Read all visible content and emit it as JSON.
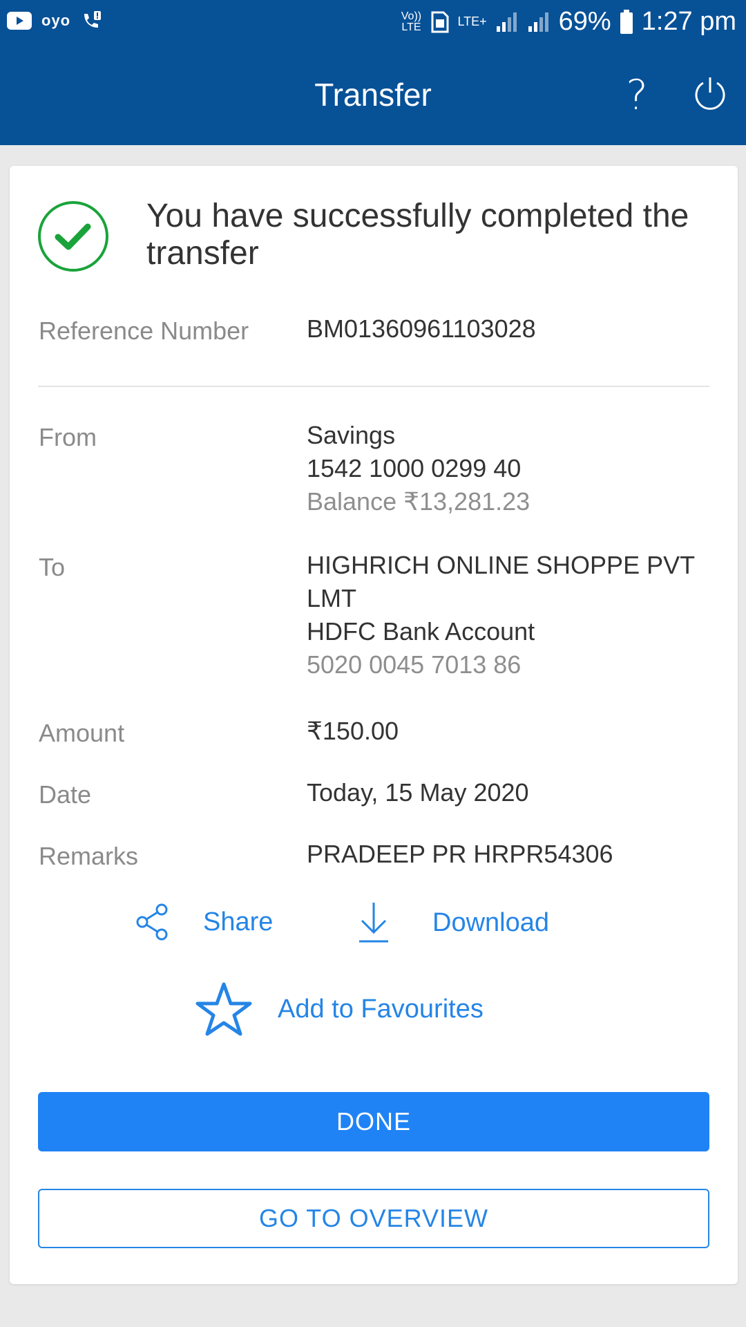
{
  "status_bar": {
    "left_icons": [
      "youtube-icon",
      "oyo-icon",
      "call-alert-icon"
    ],
    "oyo_text": "oyo",
    "volte_text": "Vo)) LTE",
    "lte_text": "LTE+",
    "battery_percent": "69%",
    "time": "1:27 pm"
  },
  "header": {
    "title": "Transfer",
    "help_label": "?",
    "icons": [
      "help-icon",
      "power-icon"
    ]
  },
  "success": {
    "message": "You have successfully completed the transfer",
    "icon": "check-circle-icon",
    "accent_color": "#1aa33a"
  },
  "details": {
    "reference": {
      "label": "Reference Number",
      "value": "BM01360961103028"
    },
    "from": {
      "label": "From",
      "account_type": "Savings",
      "account_number": "1542 1000 0299 40",
      "balance": "Balance ₹13,281.23"
    },
    "to": {
      "label": "To",
      "name": "HIGHRICH ONLINE SHOPPE PVT LMT",
      "bank": "HDFC Bank Account",
      "account_number": "5020 0045 7013 86"
    },
    "amount": {
      "label": "Amount",
      "value": "₹150.00"
    },
    "date": {
      "label": "Date",
      "value": "Today, 15 May 2020"
    },
    "remarks": {
      "label": "Remarks",
      "value": "PRADEEP PR HRPR54306"
    }
  },
  "actions": {
    "share": "Share",
    "download": "Download",
    "favourites": "Add to Favourites"
  },
  "buttons": {
    "done": "DONE",
    "overview": "GO TO OVERVIEW"
  },
  "colors": {
    "header_bg": "#075197",
    "primary": "#1f83f5",
    "link": "#2585e6",
    "page_bg": "#e9e9e9"
  }
}
